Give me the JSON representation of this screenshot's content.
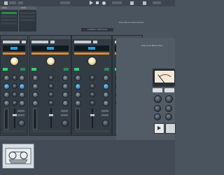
{
  "browser": {
    "header_left": "Audio",
    "header_right": "Audio"
  },
  "rack": {
    "title": "CHANNEL STRIP RACK"
  },
  "hints": {
    "top_right": "Drop Files and Devices Here",
    "bottom_right": "Drop Audio Effects Here"
  },
  "colors": {
    "accent_orange": "#e08a2a",
    "lcd_blue": "#2d9fd6",
    "active_green": "#27d96a",
    "background": "#4a545e"
  },
  "icons": {
    "play": "play-icon",
    "stop": "stop-icon",
    "record": "record-icon",
    "big_play": "play-icon"
  }
}
